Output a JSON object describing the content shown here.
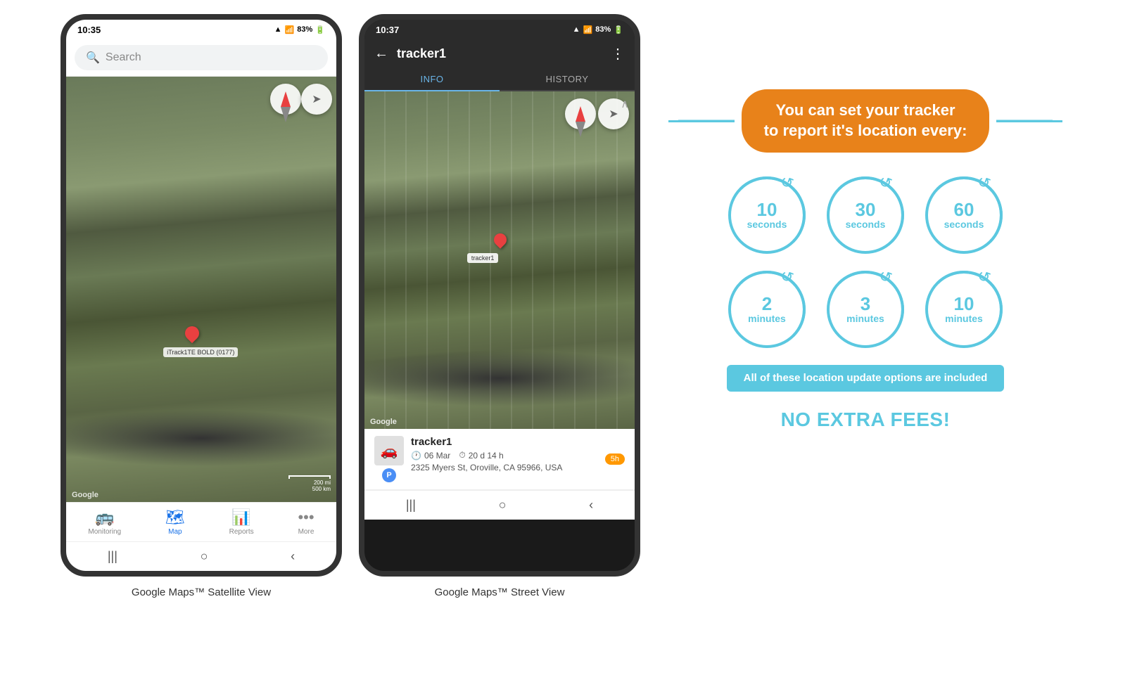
{
  "phone1": {
    "status_time": "10:35",
    "status_icons": "▲ .ull 83%▪",
    "search_placeholder": "Search",
    "tracker_label": "iTrack1TE BOLD (0177)",
    "google_label": "Google",
    "scale_line1": "200 mi",
    "scale_line2": "500 km",
    "nav_items": [
      {
        "id": "monitoring",
        "label": "Monitoring",
        "icon": "🚌",
        "active": false
      },
      {
        "id": "map",
        "label": "Map",
        "icon": "🗺",
        "active": true
      },
      {
        "id": "reports",
        "label": "Reports",
        "icon": "📊",
        "active": false
      },
      {
        "id": "more",
        "label": "More",
        "icon": "•••",
        "active": false
      }
    ],
    "bottom_btns": [
      "|||",
      "○",
      "‹"
    ],
    "caption": "Google Maps™ Satellite View"
  },
  "phone2": {
    "status_time": "10:37",
    "status_icons": "▲ .ull 83%▪",
    "title": "tracker1",
    "tabs": [
      {
        "id": "info",
        "label": "INFO",
        "active": true
      },
      {
        "id": "history",
        "label": "HISTORY",
        "active": false
      }
    ],
    "tracker_name": "tracker1",
    "tracker_date": "06 Mar",
    "tracker_duration": "20 d 14 h",
    "tracker_address": "2325 Myers St, Oroville, CA 95966, USA",
    "tracker_badge": "5h",
    "google_label": "Google",
    "bottom_btns": [
      "|||",
      "○",
      "‹"
    ],
    "caption": "Google Maps™ Street View"
  },
  "info_panel": {
    "header_text": "You can set your tracker\nto report it's location every:",
    "circles_row1": [
      {
        "number": "10",
        "unit": "seconds"
      },
      {
        "number": "30",
        "unit": "seconds"
      },
      {
        "number": "60",
        "unit": "seconds"
      }
    ],
    "circles_row2": [
      {
        "number": "2",
        "unit": "minutes"
      },
      {
        "number": "3",
        "unit": "minutes"
      },
      {
        "number": "10",
        "unit": "minutes"
      }
    ],
    "include_banner": "All of these location update options are included",
    "no_fees": "NO EXTRA FEES!",
    "accent_color": "#e8821a",
    "teal_color": "#5bc8e0"
  }
}
